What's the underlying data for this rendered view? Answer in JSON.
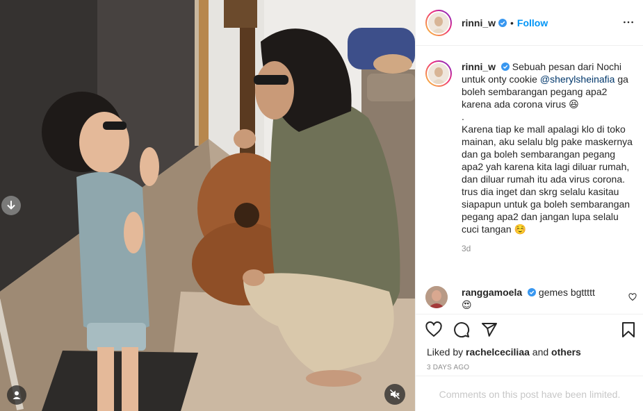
{
  "post": {
    "username": "rinni_w",
    "follow_label": "Follow",
    "separator": "•"
  },
  "caption": {
    "username": "rinni_w",
    "text_before_mention": "Sebuah pesan dari Nochi untuk onty cookie ",
    "mention": "@sherylsheinafia",
    "text_after_mention": " ga boleh sembarangan pegang apa2 karena ada corona virus 😆",
    "dot_line": ".",
    "paragraph2": "Karena tiap ke mall apalagi klo di toko mainan, aku selalu blg pake maskernya dan ga boleh sembarangan pegang apa2 yah karena kita lagi diluar rumah, dan diluar rumah itu ada virus corona. trus dia inget dan skrg selalu kasitau siapapun untuk ga boleh sembarangan pegang apa2 dan jangan lupa selalu cuci tangan ☺️",
    "time": "3d"
  },
  "comments": [
    {
      "username": "ranggamoela",
      "text": "gemes bgttttt",
      "emoji": "😍"
    }
  ],
  "likes": {
    "prefix": "Liked by",
    "user": "rachelceciliaa",
    "conjunction": "and",
    "others": "others"
  },
  "date": "3 DAYS AGO",
  "comments_limited": "Comments on this post have been limited.",
  "icons": {
    "verified": "verified-badge-icon",
    "more": "more-options-icon",
    "like": "heart-icon",
    "comment": "comment-icon",
    "share": "share-icon",
    "save": "bookmark-icon",
    "mute": "mute-icon",
    "user_tag": "user-tag-icon",
    "prev": "arrow-down-icon"
  },
  "colors": {
    "accent": "#0095f6",
    "text": "#262626",
    "muted": "#8e8e8e",
    "mention": "#00376b"
  }
}
